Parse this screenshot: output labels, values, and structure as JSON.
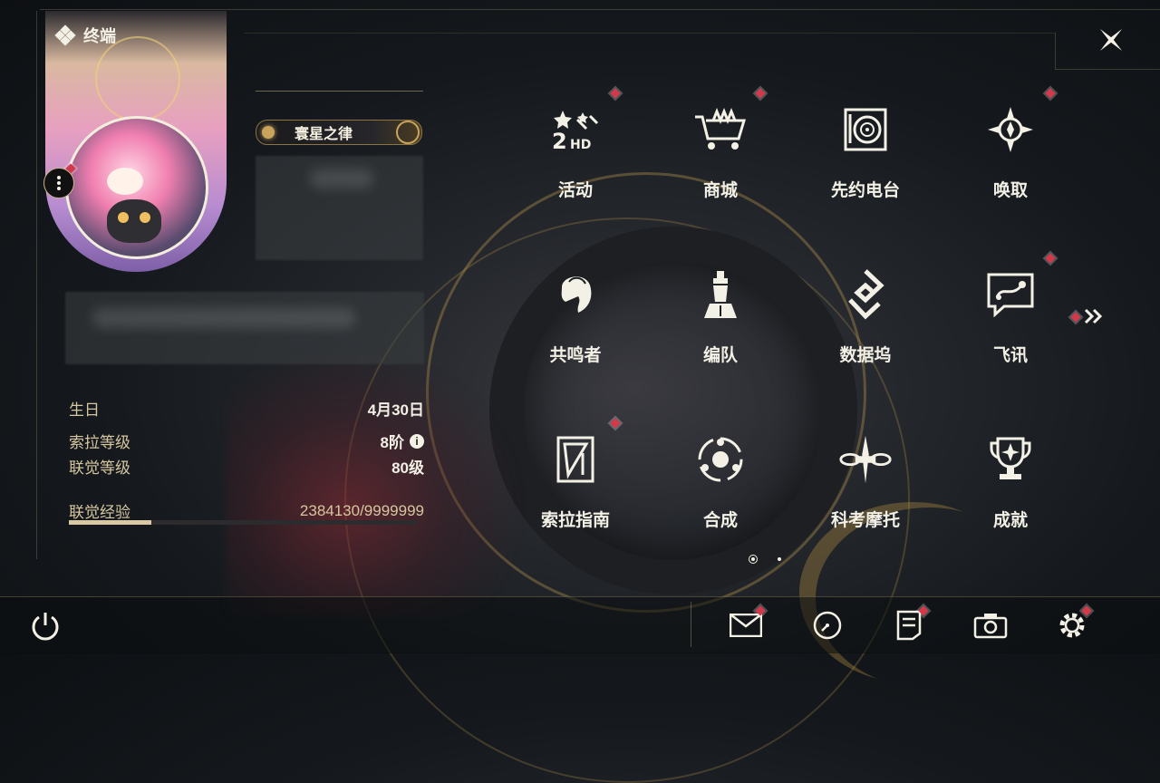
{
  "header": {
    "title": "终端"
  },
  "profile": {
    "title_badge": "寰星之律"
  },
  "info": {
    "birthday_label": "生日",
    "birthday_value": "4月30日",
    "sola_level_label": "索拉等级",
    "sola_level_value": "8阶",
    "union_level_label": "联觉等级",
    "union_level_value": "80级",
    "union_exp_label": "联觉经验",
    "union_exp_value": "2384130/9999999",
    "union_exp_progress": 0.238
  },
  "menu": {
    "items": [
      {
        "label": "活动",
        "icon": "events-2hd-icon",
        "notify": true
      },
      {
        "label": "商城",
        "icon": "shop-cart-icon",
        "notify": true
      },
      {
        "label": "先约电台",
        "icon": "radio-record-icon",
        "notify": false
      },
      {
        "label": "唤取",
        "icon": "convene-compass-icon",
        "notify": true
      },
      {
        "label": "共鸣者",
        "icon": "resonator-portrait-icon",
        "notify": false
      },
      {
        "label": "编队",
        "icon": "team-chess-icon",
        "notify": false
      },
      {
        "label": "数据坞",
        "icon": "data-bank-icon",
        "notify": false
      },
      {
        "label": "飞讯",
        "icon": "chat-bubble-icon",
        "notify": true
      },
      {
        "label": "索拉指南",
        "icon": "guidebook-icon",
        "notify": true
      },
      {
        "label": "合成",
        "icon": "synthesis-icon",
        "notify": false
      },
      {
        "label": "科考摩托",
        "icon": "motorbike-icon",
        "notify": false
      },
      {
        "label": "成就",
        "icon": "trophy-icon",
        "notify": false
      }
    ]
  },
  "pagination": {
    "pages": 2,
    "current": 1
  },
  "bottom": {
    "icons": [
      "power-icon",
      "mail-icon",
      "clock-icon",
      "notice-icon",
      "camera-icon",
      "settings-gear-icon"
    ]
  },
  "colors": {
    "accent_gold": "#c9a45a",
    "notify_red": "#d23a4c",
    "text": "#f3f0e6"
  }
}
